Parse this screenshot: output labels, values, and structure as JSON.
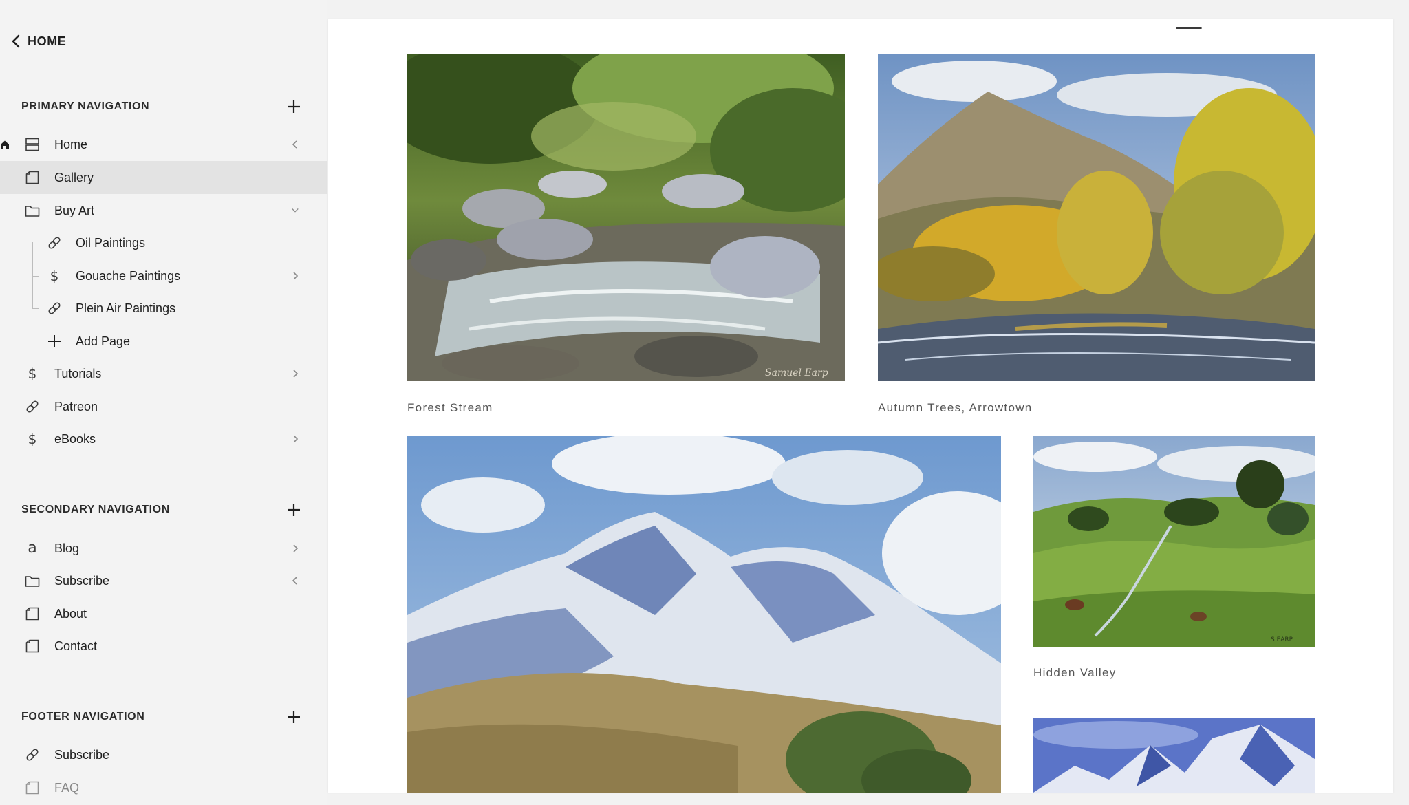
{
  "back": {
    "label": "HOME"
  },
  "sections": {
    "primary": {
      "title": "PRIMARY NAVIGATION"
    },
    "secondary": {
      "title": "SECONDARY NAVIGATION"
    },
    "footer": {
      "title": "FOOTER NAVIGATION"
    }
  },
  "primary_nav": {
    "home": "Home",
    "gallery": "Gallery",
    "buy_art": "Buy Art",
    "oil": "Oil Paintings",
    "gouache": "Gouache Paintings",
    "plein_air": "Plein Air Paintings",
    "add_page": "Add Page",
    "tutorials": "Tutorials",
    "patreon": "Patreon",
    "ebooks": "eBooks"
  },
  "secondary_nav": {
    "blog": "Blog",
    "subscribe": "Subscribe",
    "about": "About",
    "contact": "Contact"
  },
  "footer_nav": {
    "subscribe": "Subscribe",
    "faq": "FAQ"
  },
  "gallery": {
    "captions": {
      "forest_stream": "Forest Stream",
      "autumn_trees": "Autumn Trees, Arrowtown",
      "hidden_valley": "Hidden Valley"
    },
    "signatures": {
      "forest_stream": "Samuel Earp",
      "hidden_valley": "S EARP"
    }
  },
  "icons": {
    "page": "page-icon",
    "folder": "folder-icon",
    "link": "link-icon",
    "product": "dollar-icon",
    "blog": "blog-icon",
    "index": "index-icon"
  }
}
